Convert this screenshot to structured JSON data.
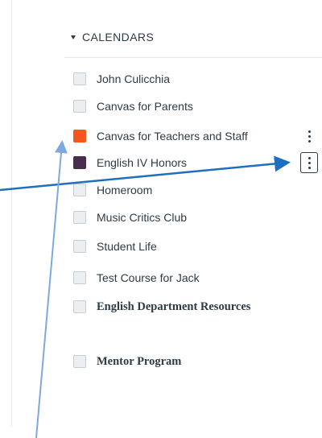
{
  "sidebar": {
    "section_title": "CALENDARS",
    "calendars": [
      {
        "label": "John Culicchia",
        "color": "#eceff1",
        "selected": false,
        "font": "sans"
      },
      {
        "label": "Canvas for Parents",
        "color": "#eceff1",
        "selected": false,
        "font": "sans"
      },
      {
        "label": "Canvas for Teachers and Staff",
        "color": "#f2571d",
        "selected": true,
        "font": "sans"
      },
      {
        "label": "English IV Honors",
        "color": "#4a2d4c",
        "selected": true,
        "font": "sans"
      },
      {
        "label": "Homeroom",
        "color": "#eceff1",
        "selected": false,
        "font": "sans"
      },
      {
        "label": "Music Critics Club",
        "color": "#eceff1",
        "selected": false,
        "font": "sans"
      },
      {
        "label": "Student Life",
        "color": "#eceff1",
        "selected": false,
        "font": "sans"
      },
      {
        "label": "Test Course for Jack",
        "color": "#eceff1",
        "selected": false,
        "font": "sans"
      },
      {
        "label": "English Department Resources",
        "color": "#eceff1",
        "selected": false,
        "font": "serif"
      },
      {
        "label": "Mentor Program",
        "color": "#eceff1",
        "selected": false,
        "font": "serif"
      }
    ],
    "icons": {
      "collapse": "caret-down-icon",
      "options": "kebab-menu-icon"
    },
    "annotation_color": "#1f6fbf"
  }
}
